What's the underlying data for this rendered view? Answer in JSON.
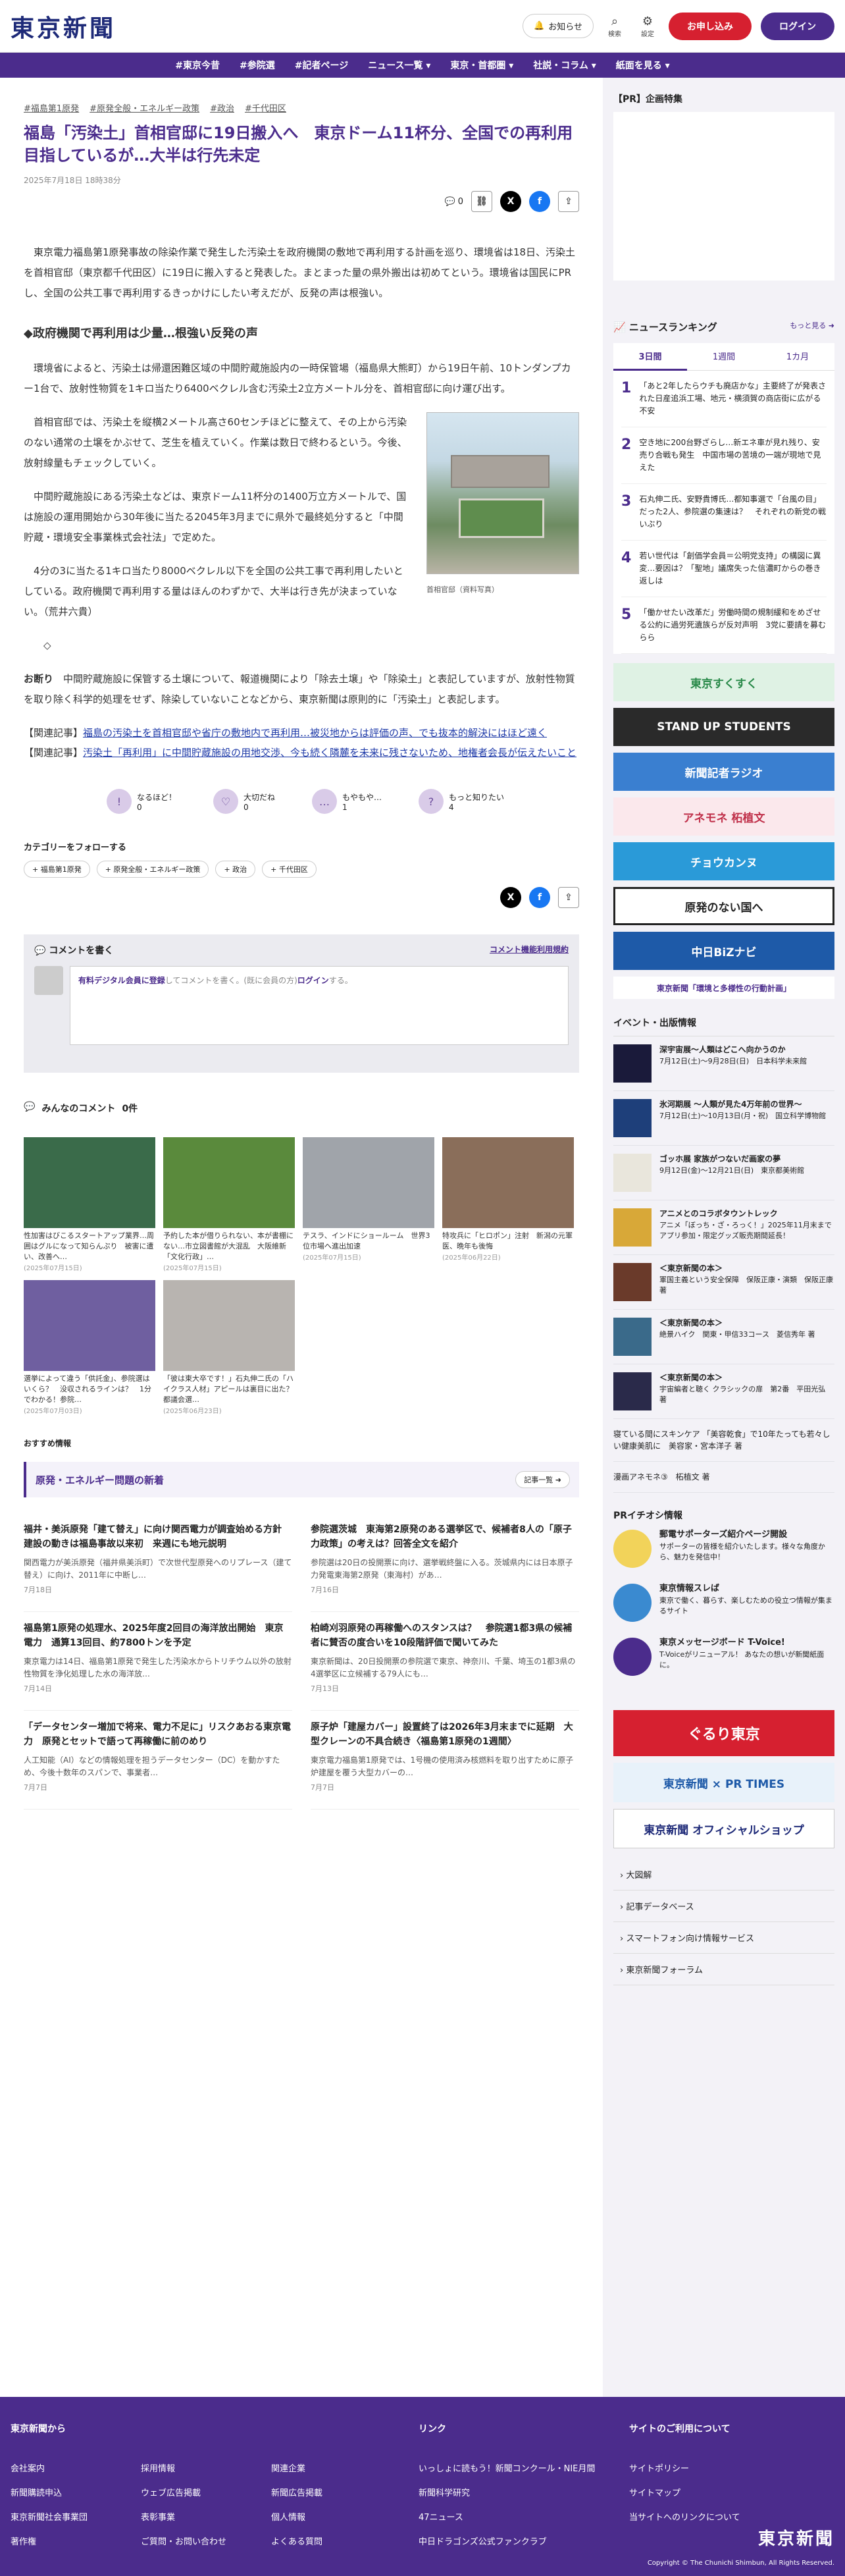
{
  "header": {
    "logo": "東京新聞",
    "notice": "お知らせ",
    "search": "検索",
    "settings": "設定",
    "apply": "お申し込み",
    "login": "ログイン"
  },
  "nav": [
    "#東京今昔",
    "#参院選",
    "#記者ページ",
    "ニュース一覧 ▾",
    "東京・首都圏 ▾",
    "社説・コラム ▾",
    "紙面を見る ▾"
  ],
  "article": {
    "tags": [
      "#福島第1原発",
      "#原発全般・エネルギー政策",
      "#政治",
      "#千代田区"
    ],
    "title": "福島「汚染土」首相官邸に19日搬入へ　東京ドーム11杯分、全国での再利用目指しているが…大半は行先未定",
    "date": "2025年7月18日 18時38分",
    "comment_count": "0",
    "p1": "東京電力福島第1原発事故の除染作業で発生した汚染土を政府機関の敷地で再利用する計画を巡り、環境省は18日、汚染土を首相官邸（東京都千代田区）に19日に搬入すると発表した。まとまった量の県外搬出は初めてという。環境省は国民にPRし、全国の公共工事で再利用するきっかけにしたい考えだが、反発の声は根強い。",
    "h2": "◆政府機関で再利用は少量…根強い反発の声",
    "p2": "環境省によると、汚染土は帰還困難区域の中間貯蔵施設内の一時保管場（福島県大熊町）から19日午前、10トンダンプカー1台で、放射性物質を1キロ当たり6400ベクレル含む汚染土2立方メートル分を、首相官邸に向け運び出す。",
    "p3": "首相官邸では、汚染土を縦横2メートル高さ60センチほどに整えて、その上から汚染のない通常の土壌をかぶせて、芝生を植えていく。作業は数日で終わるという。今後、放射線量もチェックしていく。",
    "p4": "中間貯蔵施設にある汚染土などは、東京ドーム11杯分の1400万立方メートルで、国は施設の運用開始から30年後に当たる2045年3月までに県外で最終処分すると「中間貯蔵・環境安全事業株式会社法」で定めた。",
    "p5": "4分の3に当たる1キロ当たり8000ベクレル以下を全国の公共工事で再利用したいとしている。政府機関で再利用する量はほんのわずかで、大半は行き先が決まっていない。（荒井六貴）",
    "diamond": "◇",
    "note_label": "お断り",
    "note": "中間貯蔵施設に保管する土壌について、報道機関により「除去土壌」や「除染土」と表記していますが、放射性物質を取り除く科学的処理をせず、除染していないことなどから、東京新聞は原則的に「汚染土」と表記します。",
    "photo_caption": "首相官邸（資料写真）",
    "related1_label": "【関連記事】",
    "related1": "福島の汚染土を首相官邸や省庁の敷地内で再利用…被災地からは評価の声、でも抜本的解決にはほど遠く",
    "related2_label": "【関連記事】",
    "related2": "汚染土「再利用」に中間貯蔵施設の用地交渉、今も続く隣麓を未来に残さないため、地権者会長が伝えたいこと"
  },
  "reactions": [
    {
      "label": "なるほど！",
      "count": "0",
      "icon": "!"
    },
    {
      "label": "大切だね",
      "count": "0",
      "icon": "♡"
    },
    {
      "label": "もやもや…",
      "count": "1",
      "icon": "…"
    },
    {
      "label": "もっと知りたい",
      "count": "4",
      "icon": "?"
    }
  ],
  "follow": {
    "heading": "カテゴリーをフォローする",
    "tags": [
      "+ 福島第1原発",
      "+ 原発全般・エネルギー政策",
      "+ 政治",
      "+ 千代田区"
    ]
  },
  "comment": {
    "heading": "コメントを書く",
    "terms": "コメント機能利用規約",
    "prompt_a": "有料デジタル会員に登録",
    "prompt_b": "してコメントを書く。(既に会員の方)",
    "prompt_c": "ログイン",
    "prompt_d": "する。",
    "all_label": "みんなのコメント",
    "all_count": "0件"
  },
  "thumbs": [
    {
      "title": "性加害はびこるスタートアップ業界…周囲はグルになって知らんぷり　被害に遭い、改善へ…",
      "date": "(2025年07月15日)",
      "color": "#3a6b4a"
    },
    {
      "title": "予約した本が借りられない、本が書棚にない…市立図書館が大混乱　大阪維新「文化行政」…",
      "date": "(2025年07月15日)",
      "color": "#5a8a3c"
    },
    {
      "title": "テスラ、インドにショールーム　世界3位市場へ進出加速",
      "date": "(2025年07月15日)",
      "color": "#a0a4aa"
    },
    {
      "title": "特攻兵に「ヒロポン」注射　新潟の元軍医、晩年も後悔",
      "date": "(2025年06月22日)",
      "color": "#8a6e5a"
    },
    {
      "title": "選挙によって違う「供託金」、参院選はいくら？　没収されるラインは？　1分でわかる！参院…",
      "date": "(2025年07月03日)",
      "color": "#6f5fa0"
    },
    {
      "title": "「彼は東大卒です！」石丸伸二氏の「ハイクラス人材」アピールは裏目に出た？　都議会選…",
      "date": "(2025年06月23日)",
      "color": "#b8b4b0"
    }
  ],
  "recommend": "おすすめ情報",
  "news_section": {
    "heading": "原発・エネルギー問題の新着",
    "more": "記事一覧 ➜",
    "items": [
      {
        "title": "福井・美浜原発「建て替え」に向け関西電力が調査始める方針　建設の動きは福島事故以来初　来週にも地元説明",
        "summary": "関西電力が美浜原発（福井県美浜町）で次世代型原発へのリプレース（建て替え）に向け、2011年に中断し…",
        "date": "7月18日"
      },
      {
        "title": "参院選茨城　東海第2原発のある選挙区で、候補者8人の「原子力政策」の考えは？回答全文を紹介",
        "summary": "参院選は20日の投開票に向け、選挙戦終盤に入る。茨城県内には日本原子力発電東海第2原発（東海村）があ…",
        "date": "7月16日"
      },
      {
        "title": "福島第1原発の処理水、2025年度2回目の海洋放出開始　東京電力　通算13回目、約7800トンを予定",
        "summary": "東京電力は14日、福島第1原発で発生した汚染水からトリチウム以外の放射性物質を浄化処理した水の海洋放…",
        "date": "7月14日"
      },
      {
        "title": "柏崎刈羽原発の再稼働へのスタンスは？　参院選1都3県の候補者に賛否の度合いを10段階評価で聞いてみた",
        "summary": "東京新聞は、20日投開票の参院選で東京、神奈川、千葉、埼玉の1都3県の4選挙区に立候補する79人にも…",
        "date": "7月13日"
      },
      {
        "title": "「データセンター増加で将来、電力不足に」リスクあおる東京電力　原発とセットで語って再稼働に前のめり",
        "summary": "人工知能（AI）などの情報処理を担うデータセンター（DC）を動かすため、今後十数年のスパンで、事業者…",
        "date": "7月7日"
      },
      {
        "title": "原子炉「建屋カバー」設置終了は2026年3月末までに延期　大型クレーンの不具合続き〈福島第1原発の1週間〉",
        "summary": "東京電力福島第1原発では、1号機の使用済み核燃料を取り出すために原子炉建屋を覆う大型カバーの…",
        "date": "7月7日"
      }
    ]
  },
  "sidebar": {
    "pr_heading": "【PR】企画特集",
    "ranking_heading": "ニュースランキング",
    "ranking_more": "もっと見る ➜",
    "tabs": [
      "3日間",
      "1週間",
      "1カ月"
    ],
    "ranking": [
      {
        "n": "1",
        "text": "「あと2年したらウチも廃店かな」主要終了が発表された日産追浜工場、地元・横須賀の商店街に広がる不安"
      },
      {
        "n": "2",
        "text": "空き地に200台野ざらし…新エネ車が見れ残り、安売り合戦も発生　中国市場の苦境の一端が現地で見えた"
      },
      {
        "n": "3",
        "text": "石丸伸二氏、安野貴博氏…都知事選で「台風の目」だった2人、参院選の集速は？　それぞれの新党の戦いぶり"
      },
      {
        "n": "4",
        "text": "若い世代は「創価学会員＝公明党支持」の構図に異変…要因は？「聖地」議席失った信濃町からの巻き返しは"
      },
      {
        "n": "5",
        "text": "「働かせたい改革だ」労働時間の規制緩和をめざせる公約に過労死遺族らが反対声明　3党に要請を募むらら"
      }
    ],
    "banners": [
      {
        "text": "東京すくすく",
        "bg": "#dff2e4",
        "fg": "#2a8a4a"
      },
      {
        "text": "STAND UP STUDENTS",
        "bg": "#2a2a2a",
        "fg": "#ffffff"
      },
      {
        "text": "新聞記者ラジオ",
        "bg": "#3a7fd0",
        "fg": "#ffffff"
      },
      {
        "text": "アネモネ 柘植文",
        "bg": "#fbe8ec",
        "fg": "#c0304a"
      },
      {
        "text": "チョウカンヌ",
        "bg": "#2a9ad8",
        "fg": "#ffffff"
      },
      {
        "text": "原発のない国へ",
        "bg": "#ffffff",
        "fg": "#222222"
      },
      {
        "text": "中日BiZナビ",
        "bg": "#1e5aa8",
        "fg": "#ffffff"
      },
      {
        "text": "東京新聞「環境と多様性の行動計画」",
        "bg": "#ffffff",
        "fg": "#4b2c8c"
      }
    ],
    "events_heading": "イベント・出版情報",
    "events": [
      {
        "title": "深宇宙展〜人類はどこへ向かうのか",
        "desc": "7月12日(土)〜9月28日(日)　日本科学未来館",
        "color": "#1a1a3a"
      },
      {
        "title": "氷河期展 〜人類が見た4万年前の世界〜",
        "desc": "7月12日(土)〜10月13日(月・祝)　国立科学博物館",
        "color": "#1e3f7a"
      },
      {
        "title": "ゴッホ展 家族がつないだ画家の夢",
        "desc": "9月12日(金)〜12月21日(日)　東京都美術館",
        "color": "#e9e6dc"
      },
      {
        "title": "アニメとのコラボタウントレック",
        "desc": "アニメ「ぼっち・ざ・ろっく！」2025年11月末までアプリ参加・限定グッズ販売期間延長！",
        "color": "#d8a838"
      },
      {
        "title": "＜東京新聞の本＞",
        "desc": "軍国主義という安全保障　保阪正康・演類　保阪正康 著",
        "color": "#6a3a2a"
      },
      {
        "title": "＜東京新聞の本＞",
        "desc": "絶景ハイク　関東・甲信33コース　菱信秀年 著",
        "color": "#3a6a8a"
      },
      {
        "title": "＜東京新聞の本＞",
        "desc": "宇宙編者と聴く クラシックの扉　第2番　平田光弘 著",
        "color": "#2a2a4a"
      }
    ],
    "plain_links": [
      "寝ている間にスキンケア 「美容乾食」で10年たっても若々しい健康美肌に　美容家・宮本洋子 著",
      "漫画アネモネ③　柘植文 著"
    ],
    "prt_heading": "PRイチオシ情報",
    "prt": [
      {
        "title": "郵電サポーターズ紹介ページ開設",
        "desc": "サポーターの皆様を紹介いたします。様々な角度から、魅力を発信中！",
        "color": "#f2d35a"
      },
      {
        "title": "東京情報スレば",
        "desc": "東京で働く、暮らす、楽しむための役立つ情報が集まるサイト",
        "color": "#3a8ad0"
      },
      {
        "title": "東京メッセージボード T-Voice!",
        "desc": "T-Voiceがリニューアル！ あなたの想いが新聞紙面に。",
        "color": "#4b2c8c"
      }
    ],
    "big_banners": [
      {
        "text": "ぐるり東京",
        "bg": "#d62030",
        "fg": "#ffffff"
      },
      {
        "text": "東京新聞 × PR TIMES",
        "bg": "#e8f2fa",
        "fg": "#1e5aa8"
      },
      {
        "text": "東京新聞 オフィシャルショップ",
        "bg": "#ffffff",
        "fg": "#1e2a78"
      }
    ],
    "links": [
      "› 大図解",
      "› 記事データベース",
      "› スマートフォン向け情報サービス",
      "› 東京新聞フォーラム"
    ]
  },
  "footer": {
    "col1_heading": "東京新聞から",
    "col1": [
      "会社案内",
      "採用情報",
      "関連企業",
      "新聞購読申込",
      "ウェブ広告掲載",
      "新聞広告掲載",
      "東京新聞社会事業団",
      "表彰事業",
      "個人情報",
      "著作権",
      "ご質問・お問い合わせ",
      "よくある質問"
    ],
    "col2_heading": "リンク",
    "col2": [
      "いっしょに読もう！新聞コンクール・NIE月間",
      "新聞科学研究",
      "47ニュース",
      "中日ドラゴンズ公式ファンクラブ"
    ],
    "col3_heading": "サイトのご利用について",
    "col3": [
      "サイトポリシー",
      "サイトマップ",
      "当サイトへのリンクについて"
    ],
    "logo": "東京新聞",
    "copyright": "Copyright © The Chunichi Shimbun, All Rights Reserved."
  }
}
